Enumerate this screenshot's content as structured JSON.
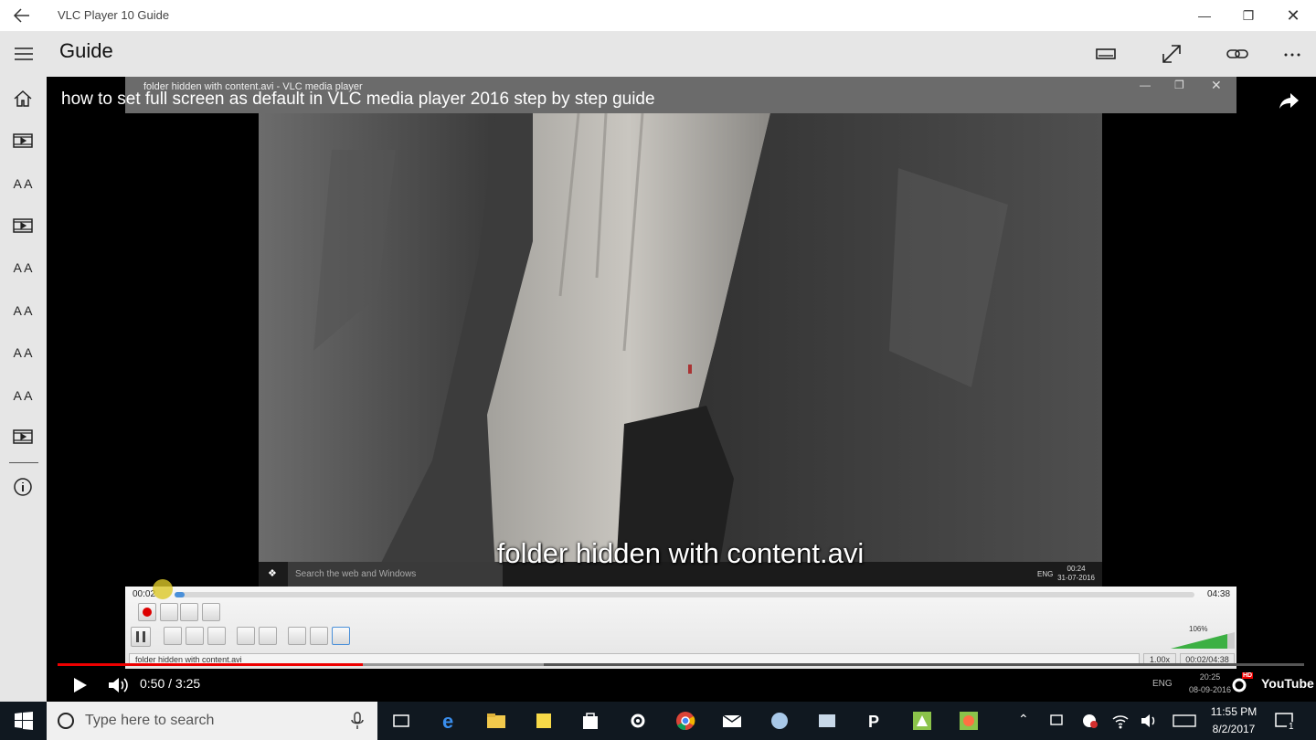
{
  "window": {
    "title": "VLC Player 10 Guide"
  },
  "header": {
    "title": "Guide"
  },
  "sidebar": {
    "items": [
      {
        "icon": "home-icon"
      },
      {
        "icon": "video-icon"
      },
      {
        "icon": "font-icon",
        "label": "A A"
      },
      {
        "icon": "video-icon"
      },
      {
        "icon": "font-icon",
        "label": "A A"
      },
      {
        "icon": "font-icon",
        "label": "A A"
      },
      {
        "icon": "font-icon",
        "label": "A A"
      },
      {
        "icon": "font-icon",
        "label": "A A"
      },
      {
        "icon": "video-icon"
      }
    ],
    "info_icon": "info-icon"
  },
  "video": {
    "title": "how to set full screen as default in VLC media player 2016 step by step guide",
    "vlc_window_title": "folder hidden with content.avi - VLC media player",
    "subtitle": "folder hidden with content.avi",
    "inner_search": "Search the web and Windows",
    "inner_lang": "ENG",
    "inner_time": "00:24",
    "inner_date": "31-07-2016",
    "vlc": {
      "elapsed": "00:02",
      "total": "04:38",
      "status": "folder hidden with content.avi",
      "speed": "1.00x",
      "duration": "00:02/04:38",
      "volume": "106%",
      "progress_fraction": 0.01
    },
    "yt": {
      "time": "0:50 / 3:25",
      "played_fraction": 0.245,
      "buffered_fraction": 0.39,
      "logo": "YouTube",
      "hd": "HD",
      "outer_lang": "ENG",
      "outer_time": "20:25",
      "outer_date": "08-09-2016"
    }
  },
  "taskbar": {
    "search_placeholder": "Type here to search",
    "time": "11:55 PM",
    "date": "8/2/2017",
    "notification_count": "1"
  }
}
